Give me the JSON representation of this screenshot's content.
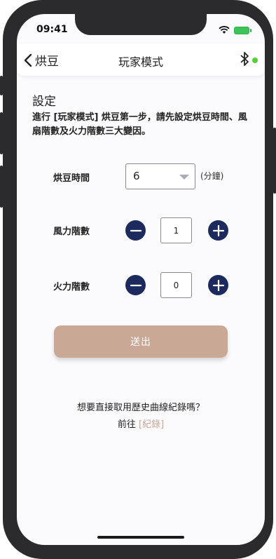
{
  "status_bar": {
    "time": "09:41"
  },
  "nav": {
    "back_label": "烘豆",
    "title": "玩家模式"
  },
  "settings": {
    "heading": "設定",
    "intro": "進行 [玩家模式] 烘豆第一步，請先設定烘豆時間、風扇階數及火力階數三大變因。"
  },
  "roast_time": {
    "label": "烘豆時間",
    "value": "6",
    "unit": "(分鐘)"
  },
  "fan_level": {
    "label": "風力階數",
    "value": "1"
  },
  "fire_level": {
    "label": "火力階數",
    "value": "0"
  },
  "submit_label": "送出",
  "history": {
    "question": "想要直接取用歷史曲線紀錄嗎？",
    "goto_prefix": "前往",
    "link_label": "[紀錄]"
  },
  "colors": {
    "accent": "#1c2a5e",
    "submit": "#c9a896",
    "status_dot": "#58cf3a"
  }
}
